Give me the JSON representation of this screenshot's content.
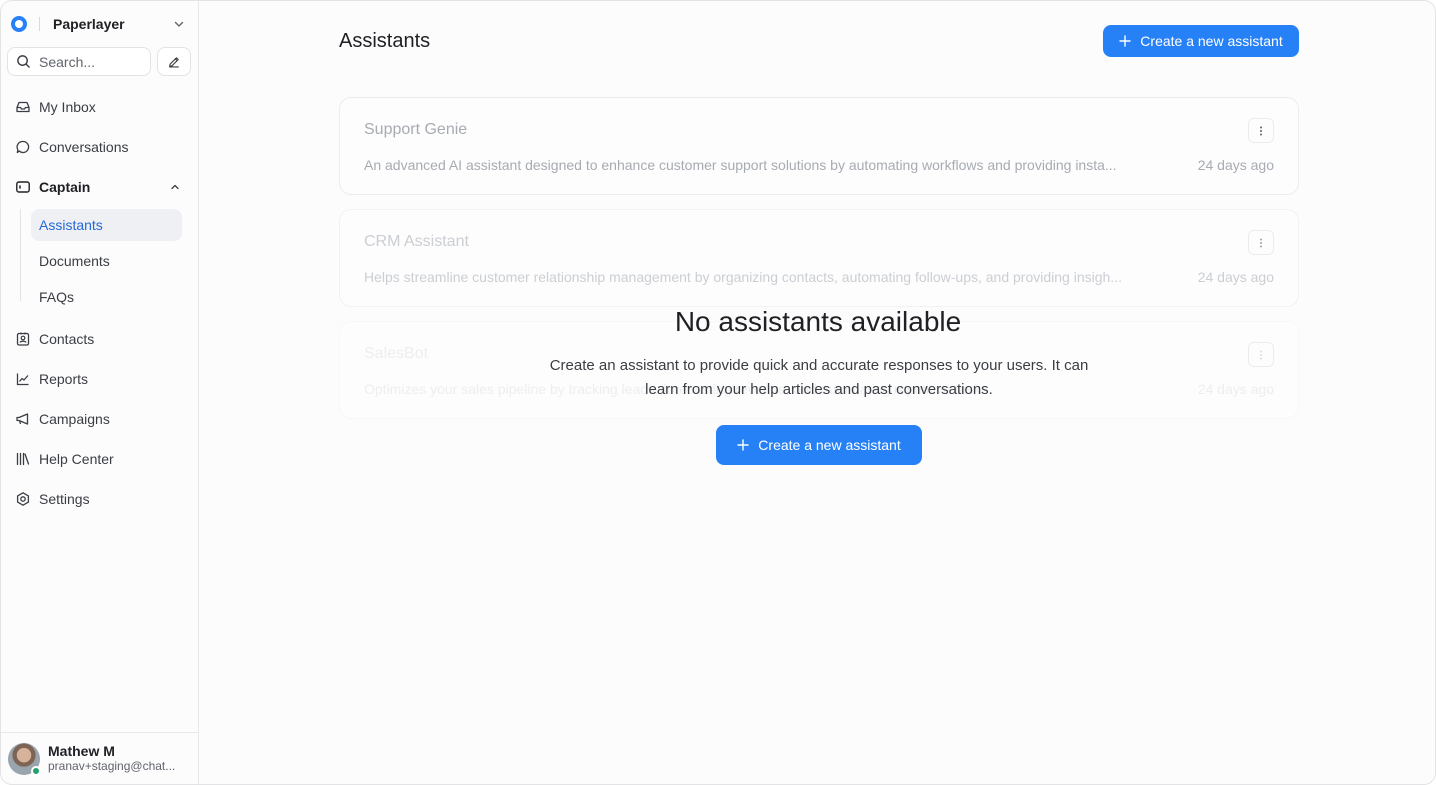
{
  "workspace": {
    "name": "Paperlayer"
  },
  "search": {
    "placeholder": "Search..."
  },
  "sidebar": {
    "items": [
      {
        "label": "My Inbox"
      },
      {
        "label": "Conversations"
      },
      {
        "label": "Captain"
      },
      {
        "label": "Contacts"
      },
      {
        "label": "Reports"
      },
      {
        "label": "Campaigns"
      },
      {
        "label": "Help Center"
      },
      {
        "label": "Settings"
      }
    ],
    "captain_sub": [
      {
        "label": "Assistants"
      },
      {
        "label": "Documents"
      },
      {
        "label": "FAQs"
      }
    ]
  },
  "user": {
    "name": "Mathew M",
    "email": "pranav+staging@chat..."
  },
  "main": {
    "title": "Assistants",
    "create_button": "Create a new assistant",
    "assistants": [
      {
        "name": "Support Genie",
        "description": "An advanced AI assistant designed to enhance customer support solutions by automating workflows and providing insta...",
        "time": "24 days ago"
      },
      {
        "name": "CRM Assistant",
        "description": "Helps streamline customer relationship management by organizing contacts, automating follow-ups, and providing insigh...",
        "time": "24 days ago"
      },
      {
        "name": "SalesBot",
        "description": "Optimizes your sales pipeline by tracking leads, forecasting revenue, and automating repetitive tasks.",
        "time": "24 days ago"
      }
    ],
    "empty_state": {
      "title": "No assistants available",
      "description": "Create an assistant to provide quick and accurate responses to your users. It can learn from your help articles and past conversations.",
      "button": "Create a new assistant"
    }
  },
  "colors": {
    "accent": "#2781f6",
    "active_text": "#2568d6",
    "active_bg": "#eef0f3",
    "status_online": "#22a06b"
  }
}
